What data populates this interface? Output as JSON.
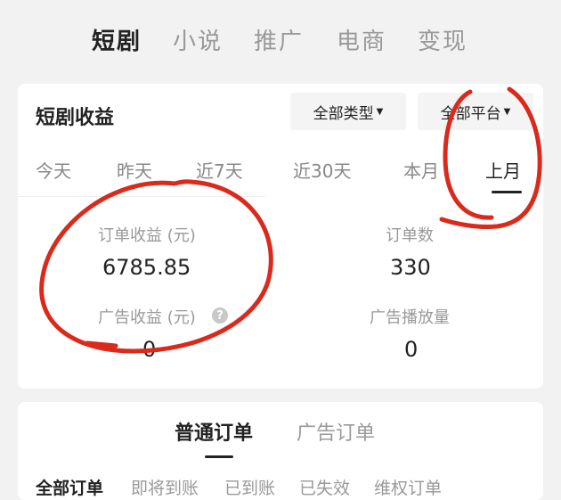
{
  "top_tabs": [
    "短剧",
    "小说",
    "推广",
    "电商",
    "变现"
  ],
  "earnings": {
    "title": "短剧收益",
    "type_filter": "全部类型",
    "platform_filter": "全部平台",
    "ranges": [
      "今天",
      "昨天",
      "近7天",
      "近30天",
      "本月",
      "上月"
    ],
    "active_range": "上月",
    "stats": {
      "order_income_label": "订单收益 (元)",
      "order_income_value": "6785.85",
      "order_count_label": "订单数",
      "order_count_value": "330",
      "ad_income_label": "广告收益 (元)",
      "ad_income_value": "0",
      "ad_plays_label": "广告播放量",
      "ad_plays_value": "0"
    }
  },
  "orders": {
    "tabs": [
      "普通订单",
      "广告订单"
    ],
    "filters": [
      "全部订单",
      "即将到账",
      "已到账",
      "已失效",
      "维权订单"
    ]
  },
  "colors": {
    "annotation": "#d92a1c"
  },
  "icons": {
    "help": "question-circle-icon",
    "dropdown": "caret-down-icon"
  }
}
